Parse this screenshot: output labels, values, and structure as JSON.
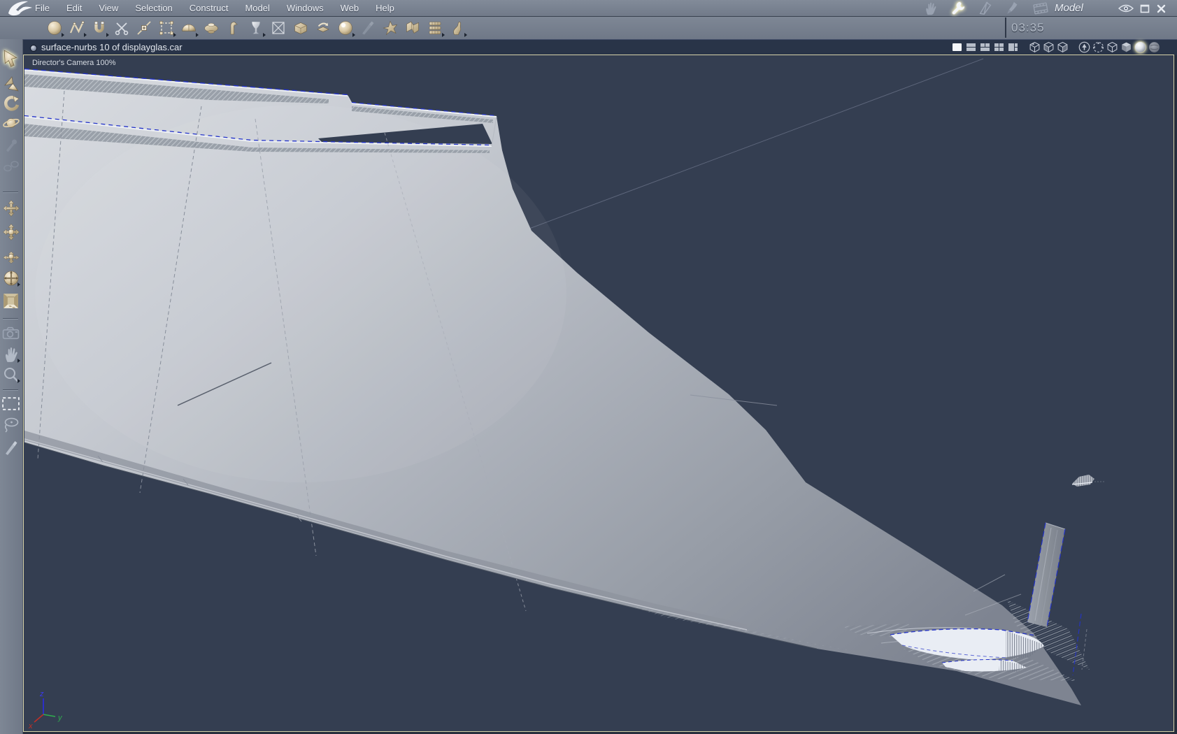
{
  "app": {
    "mode_label": "Model",
    "window_icons": [
      "eye-icon",
      "maximize-icon",
      "close-icon"
    ]
  },
  "menu_bar": {
    "items": [
      "File",
      "Edit",
      "View",
      "Selection",
      "Construct",
      "Model",
      "Windows",
      "Web",
      "Help"
    ],
    "mode_icons": [
      "assemble-hand-icon",
      "model-wrench-icon",
      "storyboard-pen-icon",
      "texture-brush-icon",
      "render-film-icon"
    ],
    "active_mode": "Model"
  },
  "toolbar": {
    "clock": "03:35",
    "tools": [
      "sphere-tool-icon",
      "polyline-tool-icon",
      "magnet-tool-icon",
      "scissors-tool-icon",
      "add-point-tool-icon",
      "select-points-tool-icon",
      "half-sphere-tool-icon",
      "lathe-tool-icon",
      "extrude-tool-icon",
      "goblet-tool-icon",
      "delete-surface-tool-icon",
      "block-tool-icon",
      "loft-tool-icon",
      "shiny-sphere-tool-icon",
      "draw-line-tool-icon",
      "deform-tool-icon",
      "sweep-tool-icon",
      "stack-tool-icon",
      "spline-tool-icon"
    ]
  },
  "document_bar": {
    "title": "surface-nurbs 10 of displayglas.car",
    "layout_icons": [
      "layout-single-icon",
      "layout-rows-icon",
      "layout-three-pane-icon",
      "layout-quad-icon",
      "layout-large-left-icon"
    ],
    "reference_icons": [
      "reference-cube-a-icon",
      "reference-cube-b-icon",
      "reference-cube-c-icon"
    ],
    "display_icons": [
      "send-to-camera-icon",
      "rotate-gizmo-icon",
      "wireframe-mode-icon",
      "flat-shade-mode-icon",
      "smooth-shade-mode-icon",
      "textured-mode-icon"
    ],
    "active_display_mode": "smooth-shade-mode-icon"
  },
  "tool_rail": {
    "tools": [
      "select-arrow-icon",
      "move-3d-icon",
      "rotate-3d-icon",
      "universal-manipulator-icon",
      "eyedropper-icon",
      "link-tool-icon",
      "pan-xy-icon",
      "pan-ball-icon",
      "pan-plane-icon",
      "trackball-icon",
      "walkthrough-icon",
      "camera-move-icon",
      "hand-pan-icon",
      "zoom-icon",
      "marquee-select-icon",
      "lasso-select-icon",
      "paint-select-icon"
    ],
    "active_tool": "select-arrow-icon"
  },
  "viewport": {
    "camera_label": "Director's Camera 100%",
    "axis": {
      "x": "x",
      "y": "y",
      "z": "z"
    },
    "colors": {
      "background": "#343e51",
      "surface_light": "#d9dce1",
      "surface_dark": "#7e8491",
      "selection_blue": "#2433c8",
      "active_border": "#d6d2a8",
      "axis_x": "#c03028",
      "axis_y": "#2fae4e",
      "axis_z": "#2a2af0"
    }
  }
}
